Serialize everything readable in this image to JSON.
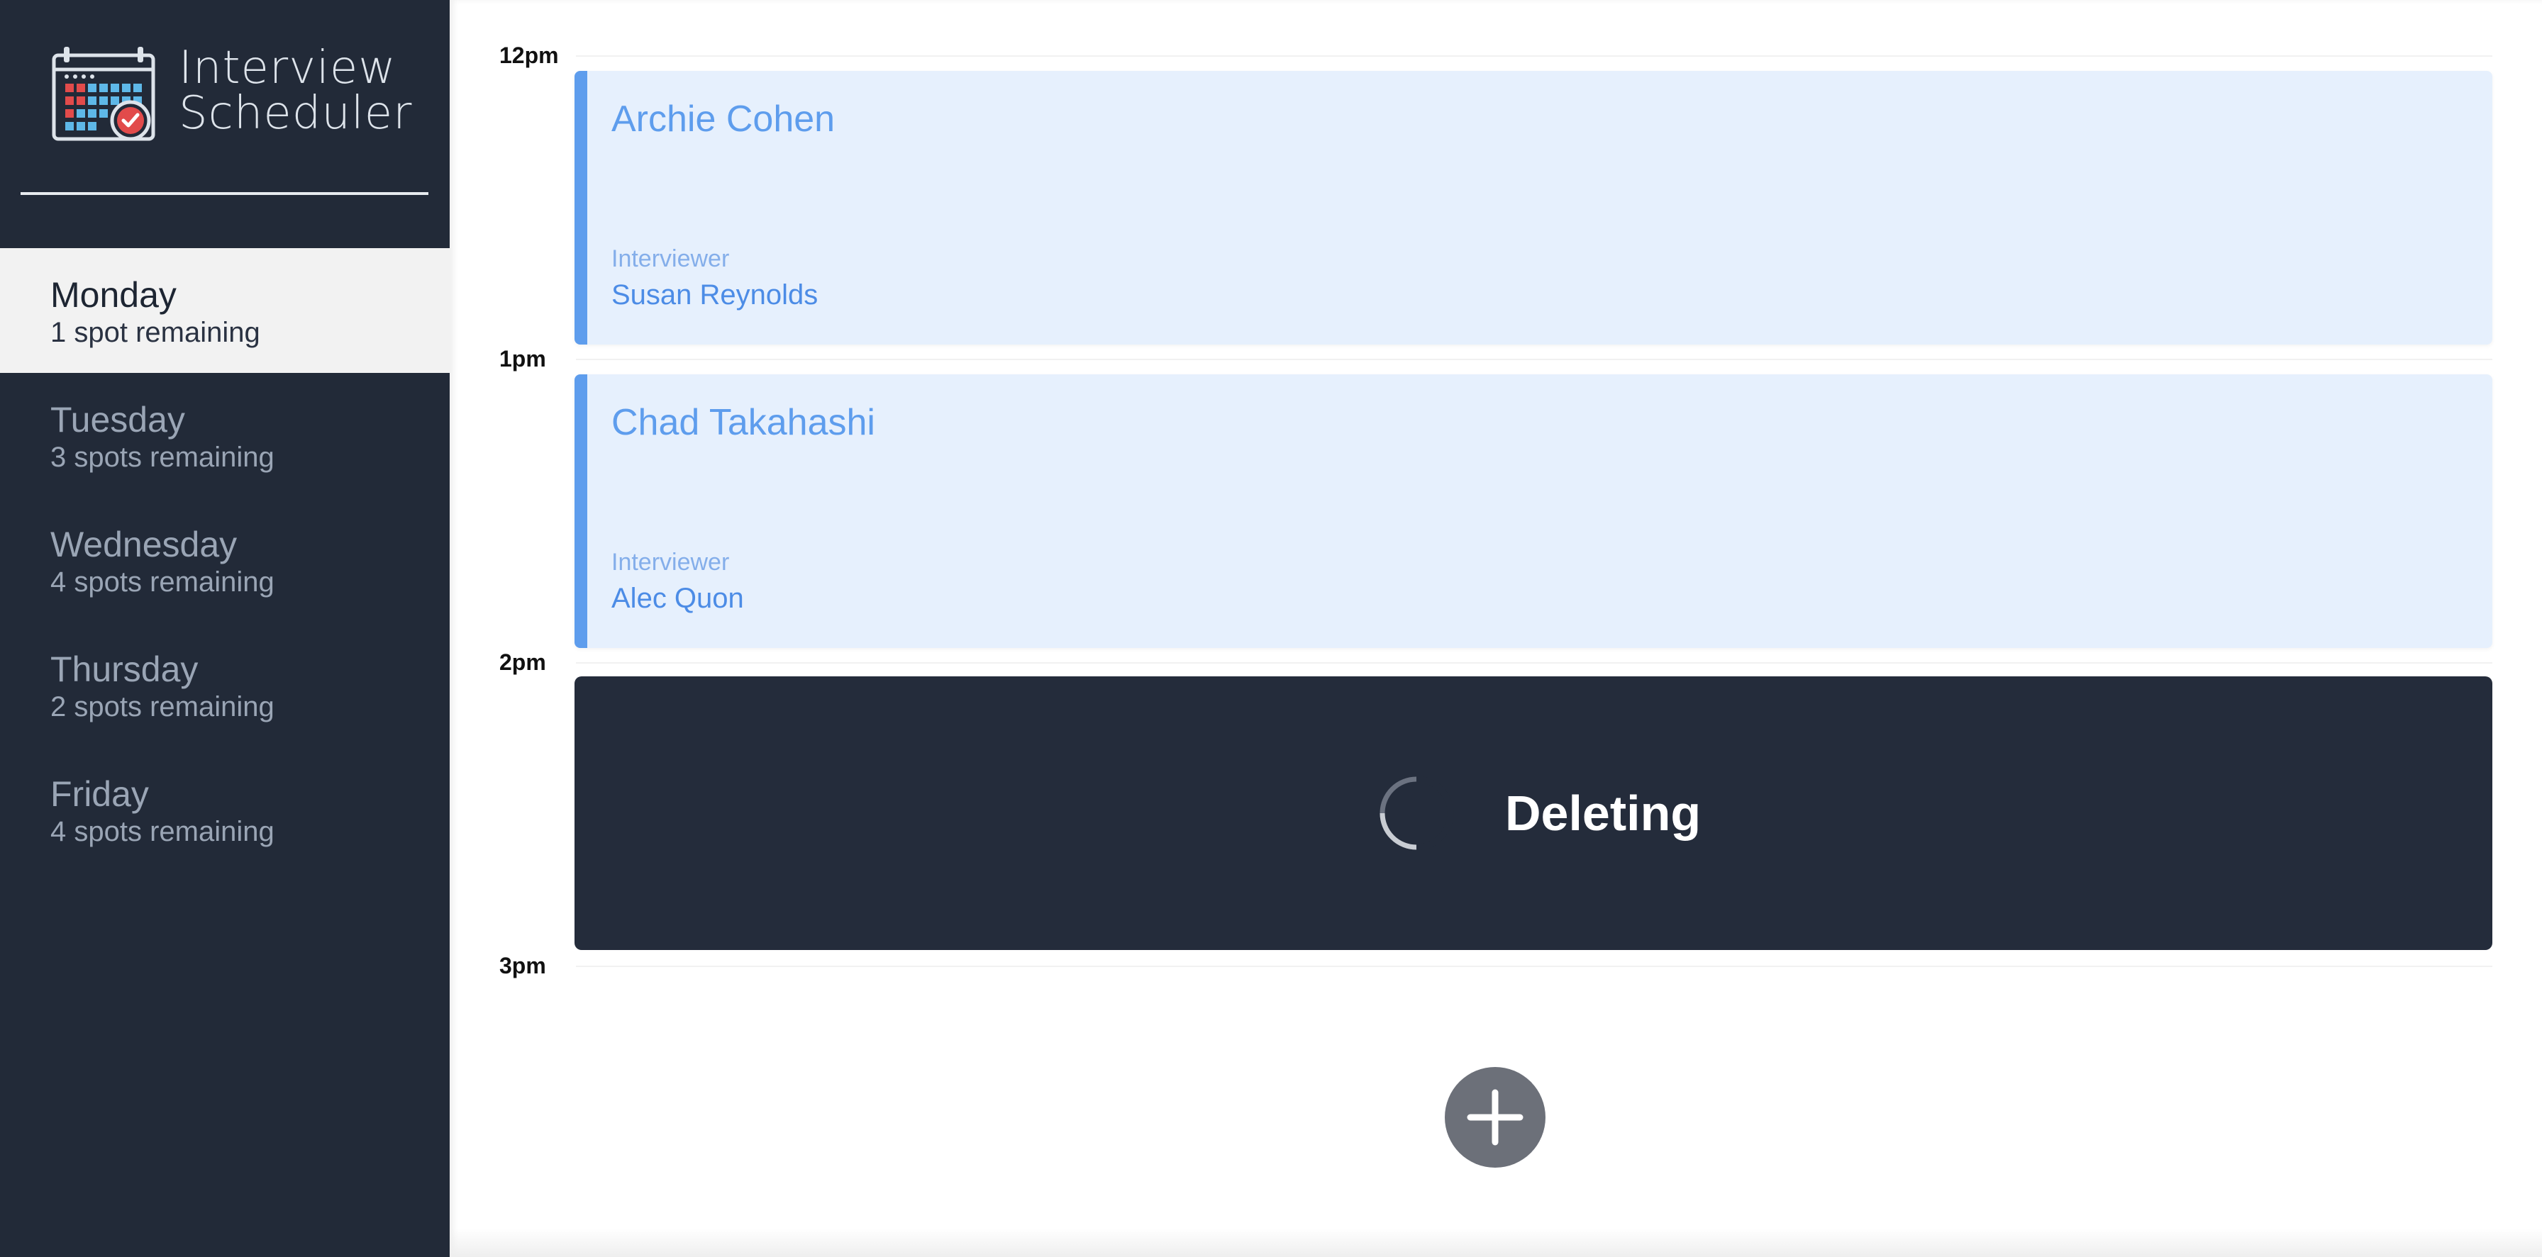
{
  "brand": {
    "line1": "Interview",
    "line2": "Scheduler",
    "logo_icon": "calendar-check-icon"
  },
  "days": [
    {
      "name": "Monday",
      "spots": "1 spot remaining",
      "selected": true
    },
    {
      "name": "Tuesday",
      "spots": "3 spots remaining",
      "selected": false
    },
    {
      "name": "Wednesday",
      "spots": "4 spots remaining",
      "selected": false
    },
    {
      "name": "Thursday",
      "spots": "2 spots remaining",
      "selected": false
    },
    {
      "name": "Friday",
      "spots": "4 spots remaining",
      "selected": false
    }
  ],
  "schedule": {
    "times": [
      "12pm",
      "1pm",
      "2pm",
      "3pm"
    ],
    "appointments": [
      {
        "student": "Archie Cohen",
        "interviewer_label": "Interviewer",
        "interviewer": "Susan Reynolds"
      },
      {
        "student": "Chad Takahashi",
        "interviewer_label": "Interviewer",
        "interviewer": "Alec Quon"
      }
    ],
    "status": {
      "text": "Deleting",
      "icon": "spinner-icon"
    },
    "add_icon": "plus-icon"
  },
  "colors": {
    "sidebar": "#222a38",
    "selected_day": "#f2f2f2",
    "appointment_bg": "#e6f0fd",
    "appointment_accent": "#5e9ded",
    "status_bg": "#242c3b",
    "add_button": "#6c7079"
  }
}
